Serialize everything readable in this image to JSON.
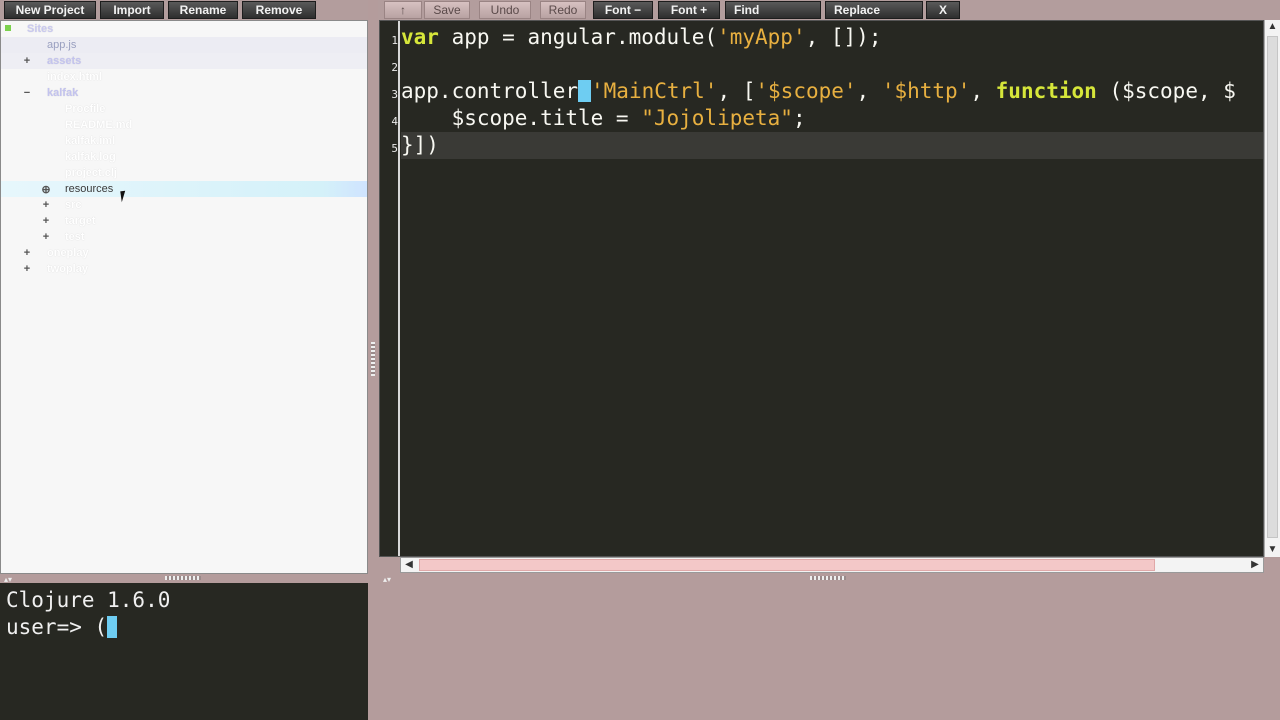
{
  "project_toolbar": {
    "new_project": "New Project",
    "import": "Import",
    "rename": "Rename",
    "remove": "Remove"
  },
  "tree": {
    "root": "Sites",
    "items": [
      {
        "label": "app.js",
        "toggle": ""
      },
      {
        "label": "assets",
        "toggle": "+"
      },
      {
        "label": "index.html",
        "toggle": ""
      },
      {
        "label": "kalfak",
        "toggle": "−"
      },
      {
        "label": "Procfile",
        "toggle": ""
      },
      {
        "label": "README.md",
        "toggle": ""
      },
      {
        "label": "kalfak.iml",
        "toggle": ""
      },
      {
        "label": "kalfak.log",
        "toggle": ""
      },
      {
        "label": "project.clj",
        "toggle": ""
      },
      {
        "label": "resources",
        "toggle": "⊕"
      },
      {
        "label": "src",
        "toggle": "+"
      },
      {
        "label": "target",
        "toggle": "+"
      },
      {
        "label": "test",
        "toggle": "+"
      },
      {
        "label": "oneplay",
        "toggle": "+"
      },
      {
        "label": "twoplay",
        "toggle": "+"
      }
    ]
  },
  "editor_toolbar": {
    "up_arrow": "↑",
    "save": "Save",
    "undo": "Undo",
    "redo": "Redo",
    "font_minus": "Font −",
    "font_plus": "Font +",
    "find": "Find",
    "replace": "Replace",
    "close": "X"
  },
  "editor": {
    "line_numbers": [
      "1",
      "2",
      "3",
      "4",
      "5"
    ],
    "line1": {
      "kw": "var",
      "mid": " app = angular.module(",
      "str": "'myApp'",
      "tail": ", []);"
    },
    "line3": {
      "pre": "app.controller",
      "str1": "'MainCtrl'",
      "mid1": ", [",
      "str2": "'$scope'",
      "mid2": ", ",
      "str3": "'$http'",
      "mid3": ", ",
      "kw": "function",
      "tail": " ($scope, $"
    },
    "line4": {
      "pre": "    $scope.title = ",
      "str": "\"Jojolipeta\"",
      "tail": ";"
    },
    "line5": {
      "text": "}])"
    }
  },
  "repl": {
    "version": "Clojure 1.6.0",
    "prompt": "user=> ("
  },
  "colors": {
    "background": "#b49c9c",
    "editor_bg": "#272822",
    "keyword": "#d6e63a",
    "string": "#e8b040",
    "cursor": "#6ecdf2"
  },
  "icons": {
    "scroll_up": "triangle-up",
    "scroll_down": "triangle-down",
    "scroll_left": "triangle-left",
    "scroll_right": "triangle-right"
  }
}
